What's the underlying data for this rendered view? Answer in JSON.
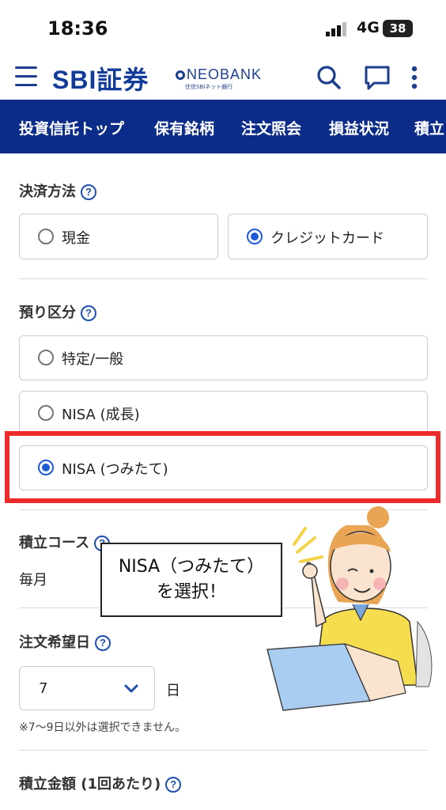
{
  "status_bar": {
    "time": "18:36",
    "network": "4G",
    "battery": "38"
  },
  "header": {
    "brand": "SBI証券",
    "partner_main": "NEOBANK",
    "partner_sub": "住信SBIネット銀行"
  },
  "nav_tabs": [
    "投資信託トップ",
    "保有銘柄",
    "注文照会",
    "損益状況",
    "積立"
  ],
  "payment": {
    "label": "決済方法",
    "options": [
      {
        "label": "現金",
        "selected": false
      },
      {
        "label": "クレジットカード",
        "selected": true
      }
    ]
  },
  "account": {
    "label": "預り区分",
    "options": [
      {
        "label": "特定/一般",
        "selected": false
      },
      {
        "label": "NISA (成長)",
        "selected": false
      },
      {
        "label": "NISA (つみたて)",
        "selected": true
      }
    ]
  },
  "course": {
    "label": "積立コース",
    "value": "毎月"
  },
  "callout": {
    "line1": "NISA（つみたて）",
    "line2": "を選択！"
  },
  "order_date": {
    "label": "注文希望日",
    "value": "7",
    "unit": "日",
    "note": "※7〜9日以外は選択できません。"
  },
  "amount": {
    "label": "積立金額 (1回あたり)"
  },
  "help_glyph": "?",
  "colors": {
    "brand": "#0c2c8a",
    "accent": "#1d5ad6",
    "highlight": "#ee2b2b"
  },
  "icons": [
    "menu-icon",
    "search-icon",
    "chat-icon",
    "more-vert-icon",
    "help-icon",
    "chevron-down-icon"
  ]
}
